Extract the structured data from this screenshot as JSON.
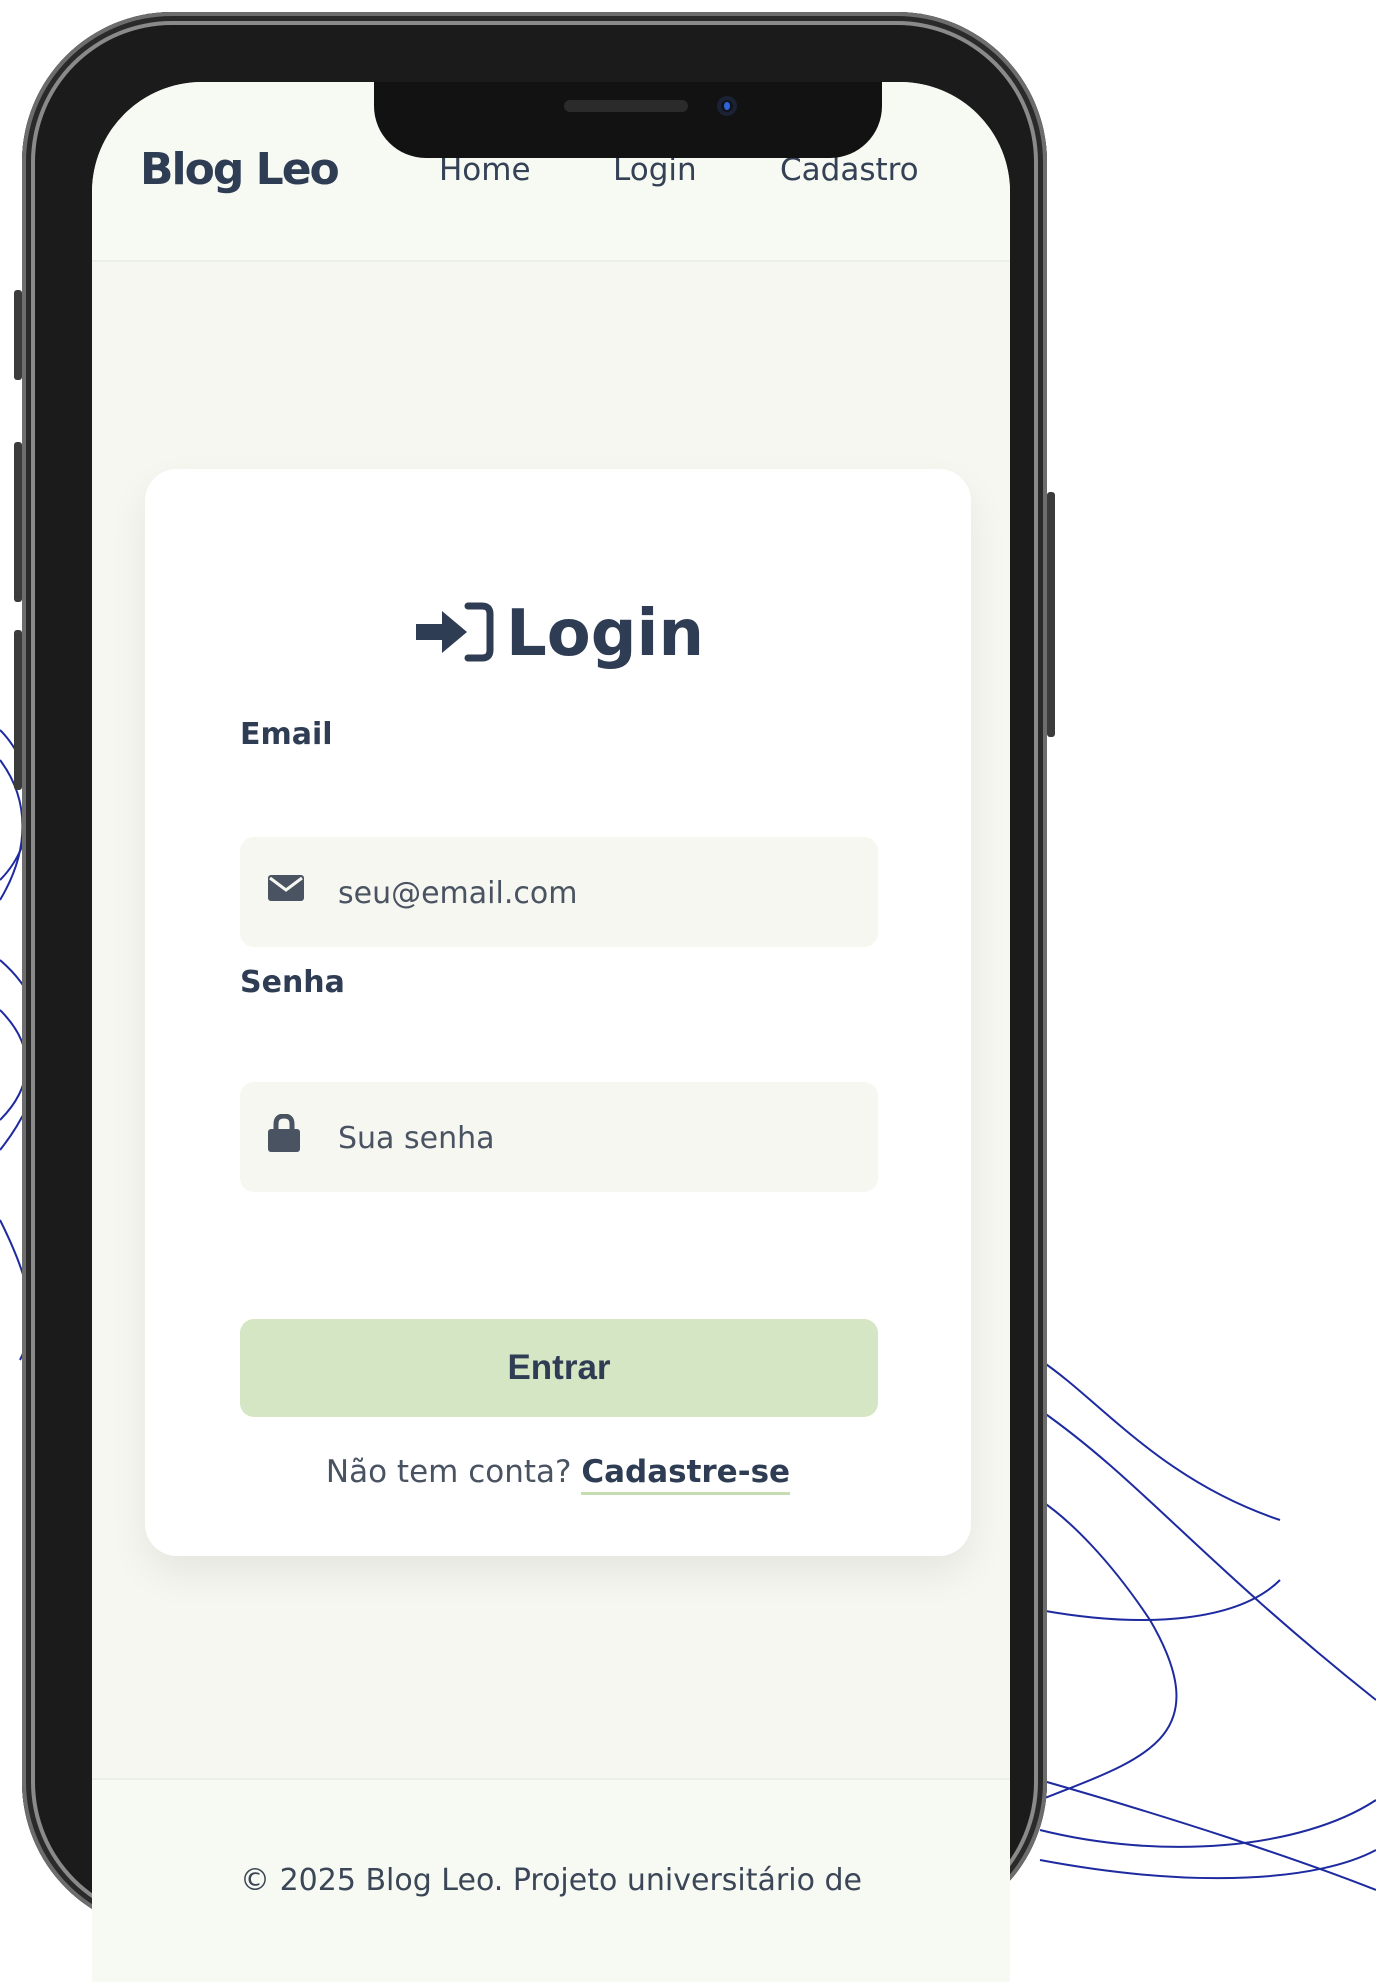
{
  "navbar": {
    "brand": "Blog Leo",
    "links": [
      "Home",
      "Login",
      "Cadastro"
    ]
  },
  "login_card": {
    "title": "Login",
    "title_icon": "sign-in-icon",
    "email": {
      "label": "Email",
      "placeholder": "seu@email.com",
      "icon": "envelope-icon"
    },
    "password": {
      "label": "Senha",
      "placeholder": "Sua senha",
      "icon": "lock-icon"
    },
    "submit_label": "Entrar",
    "signup_prompt": "Não tem conta?",
    "signup_link": "Cadastre-se"
  },
  "footer": {
    "text": "© 2025 Blog Leo. Projeto universitário de"
  },
  "colors": {
    "primary_text": "#2f3d54",
    "page_bg": "#f6f7f0",
    "button_bg": "#d4e6c3",
    "decor_lines": "#1e2aa0"
  }
}
